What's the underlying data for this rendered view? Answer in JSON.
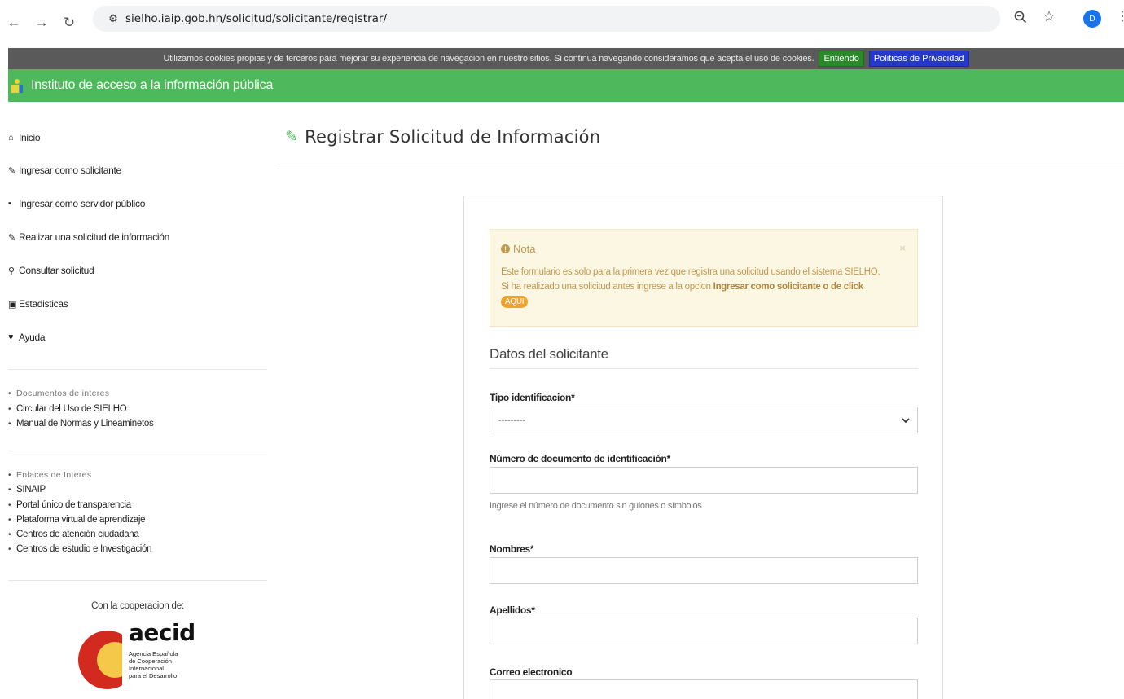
{
  "browser": {
    "url": "sielho.iaip.gob.hn/solicitud/solicitante/registrar/",
    "avatar_letter": "D"
  },
  "cookie_bar": {
    "text": "Utilizamos cookies propias y de terceros para mejorar su experiencia de navegacion en nuestro sitios. Si continua navegando consideramos que acepta el uso de cookies.",
    "accept_label": "Entiendo",
    "privacy_label": "Politicas de Privacidad"
  },
  "header": {
    "title": "Instituto de acceso a la información pública",
    "color": "#4db95c"
  },
  "sidebar": {
    "items": [
      {
        "label": "Inicio",
        "icon": "home-icon"
      },
      {
        "label": "Ingresar como solicitante",
        "icon": "edit-icon"
      },
      {
        "label": "Ingresar como servidor público",
        "icon": "edit-square-icon"
      },
      {
        "label": "Realizar una solicitud de información",
        "icon": "edit-icon"
      },
      {
        "label": "Consultar solicitud",
        "icon": "search-icon"
      },
      {
        "label": "Estadisticas",
        "icon": "chart-icon"
      },
      {
        "label": "Ayuda",
        "icon": "heart-icon"
      }
    ],
    "documents_title": "Documentos de interes",
    "documents": [
      "Circular del Uso de SIELHO",
      "Manual de Normas y Lineaminetos"
    ],
    "links_title": "Enlaces de Interes",
    "links": [
      "SINAIP",
      "Portal único de transparencia",
      "Plataforma virtual de aprendizaje",
      "Centros de atención ciudadana",
      "Centros de estudio e Investigación"
    ],
    "cooperation_label": "Con la cooperacion de:",
    "logo": {
      "name": "aecid",
      "subtitle_lines": [
        "Agencia Española",
        "de Cooperación",
        "Internacional",
        "para el Desarrollo"
      ]
    }
  },
  "main": {
    "title": "Registrar Solicitud de Información",
    "note": {
      "heading": "Nota",
      "line1": "Este formulario es solo para la primera vez que registra una solicitud usando el sistema SIELHO,",
      "line2_prefix": "Si ha realizado una solicitud antes ingrese a la opcion",
      "line2_bold": "Ingresar como solicitante o de click",
      "badge": "AQUI",
      "close": "×"
    },
    "section_title": "Datos del solicitante",
    "form": {
      "tipo_label": "Tipo identificacion*",
      "tipo_value": "---------",
      "numero_label": "Número de documento de identificación*",
      "numero_help": "Ingrese el número de documento sin guiones o símbolos",
      "nombres_label": "Nombres*",
      "apellidos_label": "Apellidos*",
      "correo_label": "Correo electronico"
    }
  }
}
